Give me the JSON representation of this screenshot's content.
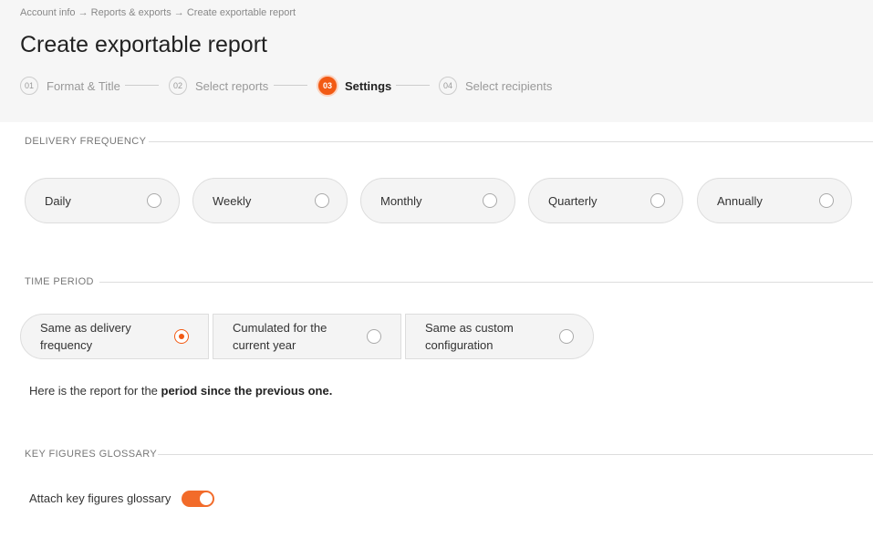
{
  "breadcrumb": {
    "items": [
      "Account info",
      "Reports & exports",
      "Create exportable report"
    ],
    "separator": "→"
  },
  "page": {
    "title": "Create exportable report"
  },
  "steps": [
    {
      "num": "01",
      "label": "Format & Title",
      "state": "done"
    },
    {
      "num": "02",
      "label": "Select reports",
      "state": "done"
    },
    {
      "num": "03",
      "label": "Settings",
      "state": "active"
    },
    {
      "num": "04",
      "label": "Select recipients",
      "state": "pending"
    }
  ],
  "delivery": {
    "title": "DELIVERY FREQUENCY",
    "options": [
      {
        "label": "Daily",
        "selected": false
      },
      {
        "label": "Weekly",
        "selected": false
      },
      {
        "label": "Monthly",
        "selected": false
      },
      {
        "label": "Quarterly",
        "selected": false
      },
      {
        "label": "Annually",
        "selected": false
      }
    ]
  },
  "period": {
    "title": "TIME PERIOD",
    "options": [
      {
        "line1": "Same as delivery",
        "line2": "frequency",
        "selected": true
      },
      {
        "line1": "Cumulated for the",
        "line2": "current year",
        "selected": false
      },
      {
        "line1": "Same as custom",
        "line2": "configuration",
        "selected": false
      }
    ],
    "note_prefix": "Here is the report for the ",
    "note_bold": "period since the previous one."
  },
  "glossary": {
    "title": "KEY FIGURES GLOSSARY",
    "toggle_label": "Attach key figures glossary",
    "enabled": true
  },
  "colors": {
    "accent": "#f25a14",
    "toggle": "#f26b2a"
  }
}
